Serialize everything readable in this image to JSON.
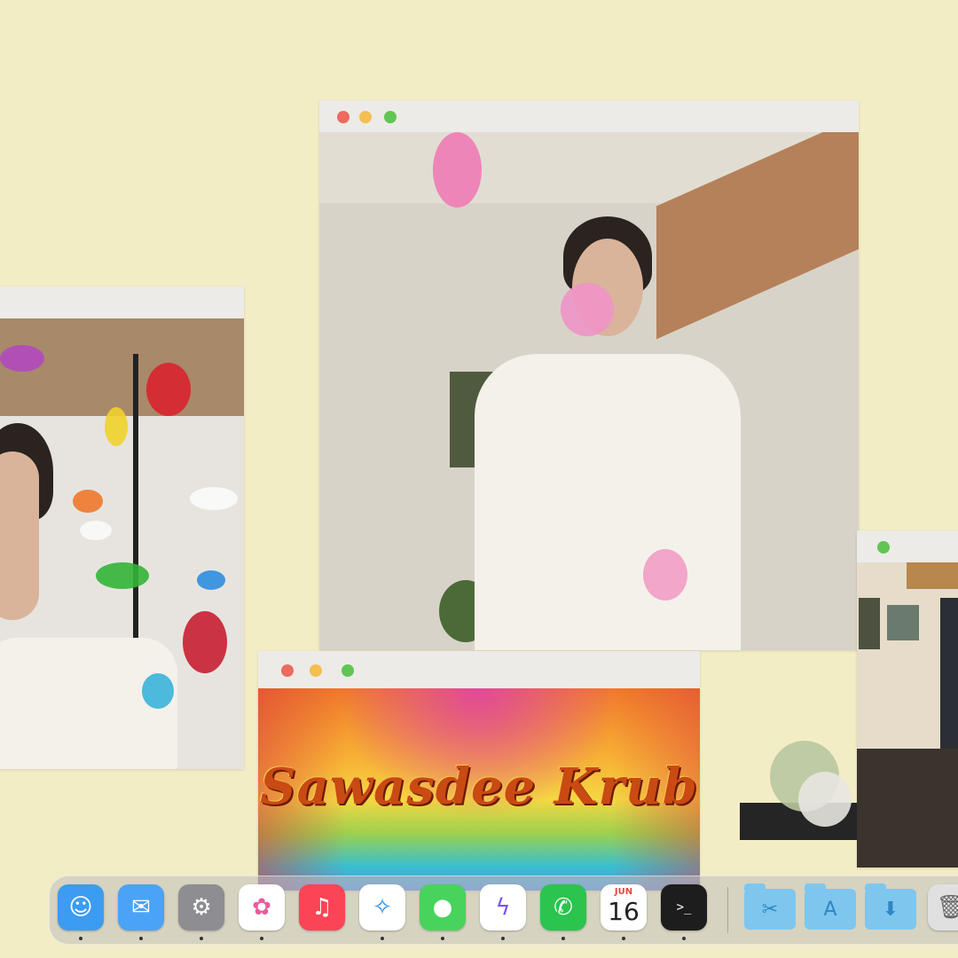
{
  "windows": {
    "title_window": {
      "text": "Sawasdee Krub"
    }
  },
  "dock": {
    "apps": [
      {
        "name": "Finder",
        "icon": "finder-icon",
        "color": "#3b9cf1"
      },
      {
        "name": "Mail",
        "icon": "mail-icon",
        "color": "#4aa3f6"
      },
      {
        "name": "System Settings",
        "icon": "gear-icon",
        "color": "#8d8d92"
      },
      {
        "name": "Photos",
        "icon": "photos-icon",
        "color": "#ffffff"
      },
      {
        "name": "Music",
        "icon": "music-icon",
        "color": "#fb4456"
      },
      {
        "name": "Safari",
        "icon": "safari-icon",
        "color": "#ffffff"
      },
      {
        "name": "Messages",
        "icon": "messages-icon",
        "color": "#48d35c"
      },
      {
        "name": "Messenger",
        "icon": "messenger-icon",
        "color": "#ffffff"
      },
      {
        "name": "WhatsApp",
        "icon": "whatsapp-icon",
        "color": "#2ac44f"
      },
      {
        "name": "Calendar",
        "icon": "calendar-icon",
        "color": "#ffffff"
      },
      {
        "name": "Terminal",
        "icon": "terminal-icon",
        "color": "#1d1d1d"
      }
    ],
    "calendar": {
      "month": "JUN",
      "day": "16"
    },
    "terminal_glyph": ">_",
    "folders": [
      {
        "icon": "utilities-folder-icon"
      },
      {
        "icon": "applications-folder-icon"
      },
      {
        "icon": "downloads-folder-icon"
      }
    ]
  }
}
